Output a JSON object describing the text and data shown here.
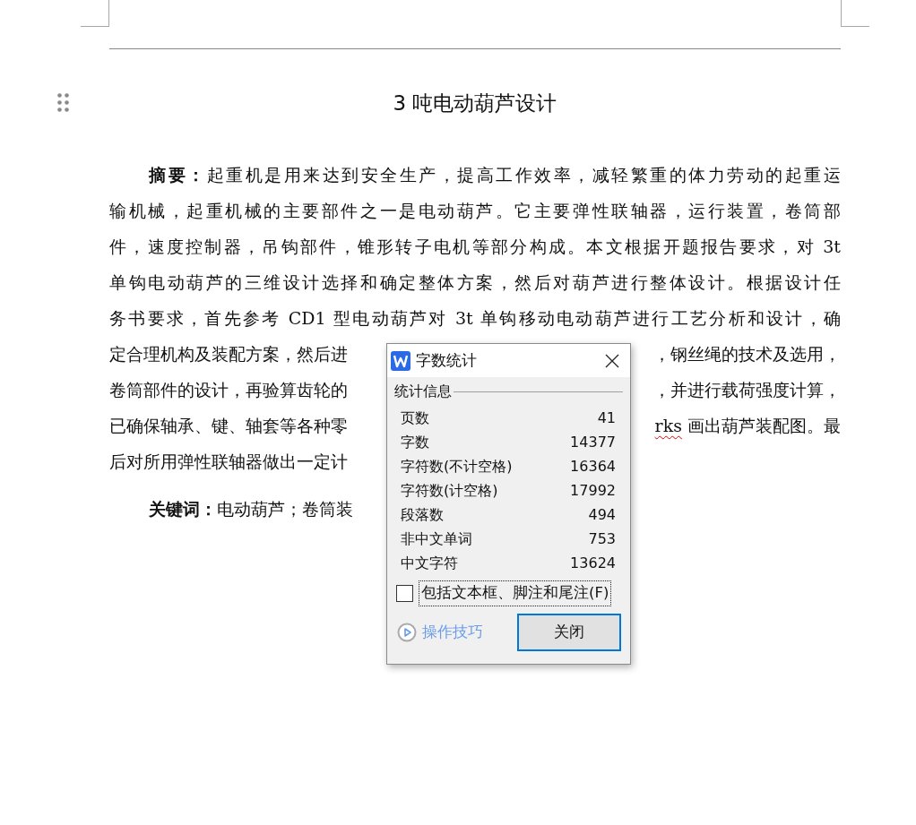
{
  "document": {
    "title": "3 吨电动葫芦设计",
    "abstract_lines": [
      {
        "left": "**摘要：**起重机是用来达到安全生产，提高工作效率，减轻繁重的体力劳动的起重运",
        "indent": true,
        "full": true
      },
      {
        "left": "输机械，起重机械的主要部件之一是电动葫芦。它主要弹性联轴器，运行装置，卷筒部",
        "indent": false,
        "full": true
      },
      {
        "left": "件，速度控制器，吊钩部件，锥形转子电机等部分构成。本文根据开题报告要求，对 3t",
        "indent": false,
        "full": true
      },
      {
        "left": "单钩电动葫芦的三维设计选择和确定整体方案，然后对葫芦进行整体设计。根据设计任",
        "indent": false,
        "full": true
      },
      {
        "left": "务书要求，首先参考 CD1 型电动葫芦对 3t 单钩移动电动葫芦进行工艺分析和设计，确",
        "indent": false,
        "full": true
      },
      {
        "left": "定合理机构及装配方案，然后进",
        "right": [
          {
            "text": "，钢丝绳的技术及选用，",
            "misspelled": false
          }
        ],
        "indent": false,
        "full": false
      },
      {
        "left": "卷筒部件的设计，再验算齿轮的",
        "right": [
          {
            "text": "，并进行载荷强度计算，",
            "misspelled": false
          }
        ],
        "indent": false,
        "full": false
      },
      {
        "left": "已确保轴承、键、轴套等各种零",
        "right": [
          {
            "text": "rks",
            "misspelled": true
          },
          {
            "text": " 画出葫芦装配图。最",
            "misspelled": false
          }
        ],
        "indent": false,
        "full": false
      },
      {
        "left": "后对所用弹性联轴器做出一定计",
        "indent": false,
        "full": false
      }
    ],
    "keywords": "**关键词：**电动葫芦；卷筒装"
  },
  "dialog": {
    "title": "字数统计",
    "group_label": "统计信息",
    "stats": [
      {
        "label": "页数",
        "value": "41"
      },
      {
        "label": "字数",
        "value": "14377"
      },
      {
        "label": "字符数(不计空格)",
        "value": "16364"
      },
      {
        "label": "字符数(计空格)",
        "value": "17992"
      },
      {
        "label": "段落数",
        "value": "494"
      },
      {
        "label": "非中文单词",
        "value": "753"
      },
      {
        "label": "中文字符",
        "value": "13624"
      }
    ],
    "include_option": {
      "label": "包括文本框、脚注和尾注(F)",
      "checked": false,
      "focused": true
    },
    "tips_link": "操作技巧",
    "close_button": {
      "label": "关闭",
      "default": true
    }
  }
}
